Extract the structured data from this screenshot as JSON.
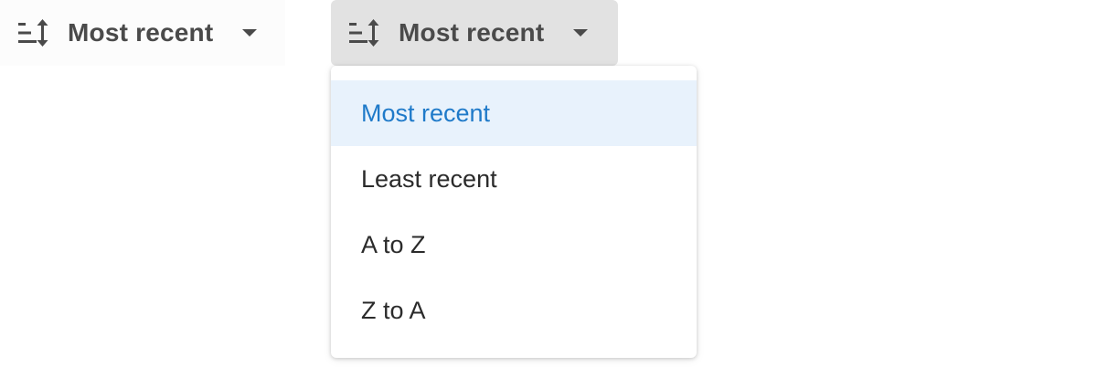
{
  "sort_dropdown_closed": {
    "icon": "sort-icon",
    "label": "Most recent",
    "caret_icon": "caret-down-icon"
  },
  "sort_dropdown_open": {
    "icon": "sort-icon",
    "label": "Most recent",
    "caret_icon": "caret-down-icon"
  },
  "menu": {
    "items": [
      {
        "label": "Most recent",
        "selected": true
      },
      {
        "label": "Least recent",
        "selected": false
      },
      {
        "label": "A to Z",
        "selected": false
      },
      {
        "label": "Z to A",
        "selected": false
      }
    ]
  },
  "colors": {
    "selected_text": "#1f7ac9",
    "selected_bg": "#e8f2fc",
    "button_active_bg": "#e2e2e2",
    "text": "#4a4a4a"
  }
}
